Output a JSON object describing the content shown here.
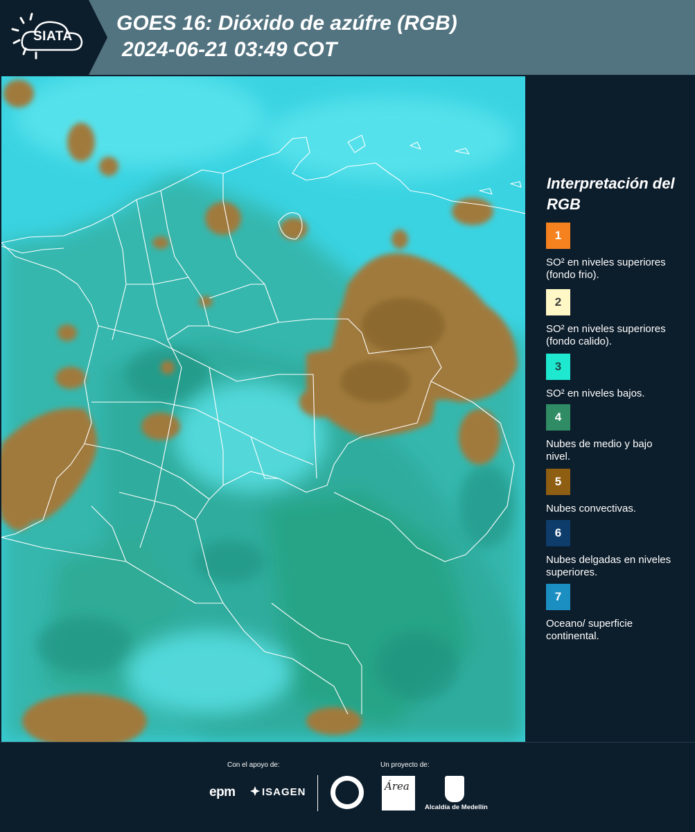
{
  "header": {
    "logo_text": "SIATA",
    "title": "GOES 16: Dióxido de azúfre (RGB)",
    "subtitle": "2024-06-21 03:49 COT",
    "background_color": "#527380"
  },
  "legend": {
    "title": "Interpretación del RGB",
    "items": [
      {
        "number": "1",
        "label": "SO² en niveles superiores (fondo frio).",
        "color": "#f5821f",
        "text_color": "#ffffff"
      },
      {
        "number": "2",
        "label": "SO² en niveles superiores (fondo calido).",
        "color": "#fff7c6",
        "text_color": "#3a3a3a"
      },
      {
        "number": "3",
        "label": "SO² en niveles bajos.",
        "color": "#1ee8cf",
        "text_color": "#1a4a4a"
      },
      {
        "number": "4",
        "label": "Nubes de medio y bajo nivel.",
        "color": "#2f8c64",
        "text_color": "#ffffff"
      },
      {
        "number": "5",
        "label": "Nubes convectivas.",
        "color": "#8e5e13",
        "text_color": "#ffffff"
      },
      {
        "number": "6",
        "label": "Nubes delgadas en niveles superiores.",
        "color": "#0e3d6b",
        "text_color": "#ffffff"
      },
      {
        "number": "7",
        "label": "Oceano/ superficie continental.",
        "color": "#1b8fc2",
        "text_color": "#ffffff"
      }
    ]
  },
  "footer": {
    "support_label": "Con el apoyo de:",
    "project_label": "Un proyecto de:",
    "sponsor_1": "epm",
    "sponsor_2": "ISAGEN",
    "project_1": "Área",
    "project_2": "Alcaldía de Medellín"
  },
  "map": {
    "ocean_color": "#38d6e4",
    "land_color": "#39b3a6",
    "convective_color": "#a37a3a",
    "border_color": "#ffffff"
  }
}
